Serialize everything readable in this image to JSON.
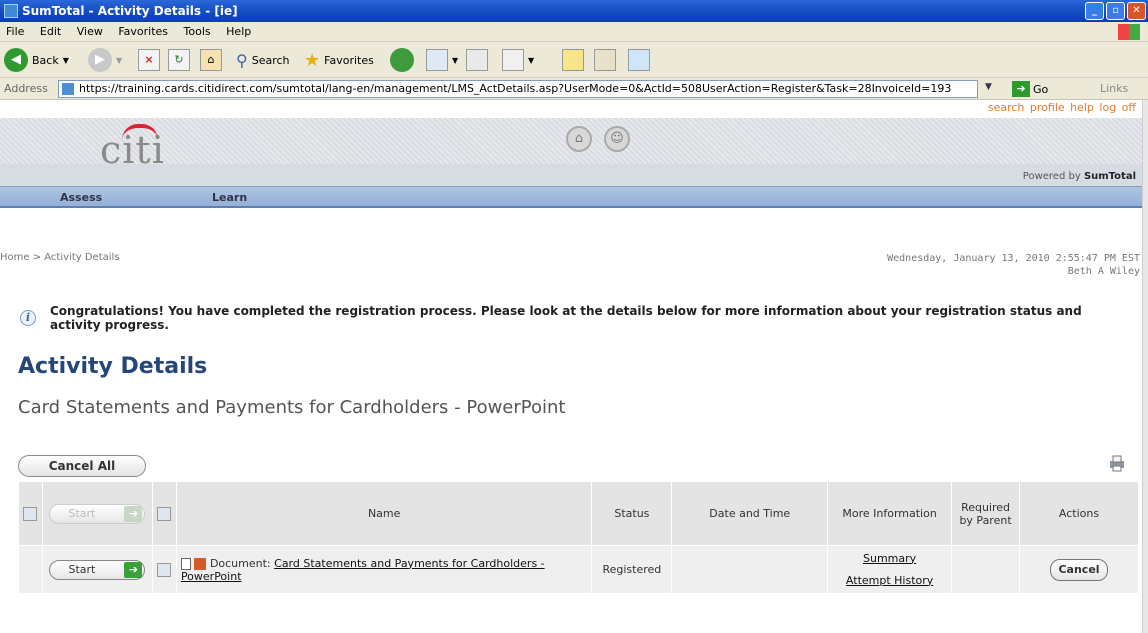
{
  "window": {
    "title": "SumTotal - Activity Details - [ie]"
  },
  "menu": [
    "File",
    "Edit",
    "View",
    "Favorites",
    "Tools",
    "Help"
  ],
  "toolbar": {
    "back": "Back",
    "search": "Search",
    "favorites": "Favorites"
  },
  "address": {
    "label": "Address",
    "url": "https://training.cards.citidirect.com/sumtotal/lang-en/management/LMS_ActDetails.asp?UserMode=0&ActId=508UserAction=Register&Task=28InvoiceId=193",
    "go": "Go",
    "links": "Links"
  },
  "header": {
    "toplinks": [
      "search",
      "profile",
      "help",
      "log off"
    ],
    "logo": "citi",
    "powered_prefix": "Powered by ",
    "powered_brand": "SumTotal"
  },
  "nav": [
    "Assess",
    "Learn"
  ],
  "breadcrumb": "Home > Activity Details",
  "datetime": {
    "date": "Wednesday, January 13, 2010 2:55:47 PM EST",
    "user": "Beth A Wiley"
  },
  "notice": "Congratulations! You have completed the registration process. Please look at the details below for more information about your registration status and activity progress.",
  "page": {
    "title": "Activity Details",
    "subtitle": "Card Statements and Payments for Cardholders - PowerPoint",
    "cancel_all": "Cancel All"
  },
  "table": {
    "headers": {
      "start": "Start",
      "name": "Name",
      "status": "Status",
      "datetime": "Date and Time",
      "more": "More Information",
      "required": "Required by Parent",
      "actions": "Actions"
    },
    "row": {
      "start": "Start",
      "type": "Document:",
      "name": "Card Statements and Payments for Cardholders - PowerPoint",
      "status": "Registered",
      "date": "",
      "summary": "Summary",
      "attempt": "Attempt History",
      "required": "",
      "cancel": "Cancel"
    }
  },
  "colors": {
    "accent": "#25467a",
    "nav": "#94b1d8",
    "go": "#3aa13a",
    "toplinks": "#e07a2e",
    "citi_red": "#d22233"
  }
}
